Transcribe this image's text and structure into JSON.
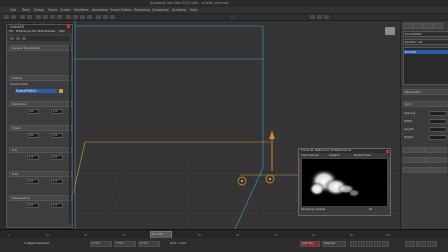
{
  "window": {
    "title": "Autodesk 3ds Max 2014  x64  -  smoke_sim.max"
  },
  "menu": [
    "Edit",
    "Tools",
    "Group",
    "Views",
    "Create",
    "Modifiers",
    "Animation",
    "Graph Editors",
    "Rendering",
    "Customize",
    "Scripting",
    "Help"
  ],
  "viewport": {
    "label": "[+] [Perspective] [Realistic]"
  },
  "fume_panel": {
    "title": "FumeFX",
    "menu": [
      "File",
      "Preferences",
      "Sim Mode",
      "Preview",
      "Help"
    ],
    "sections": [
      "General Parameters",
      "Output",
      "Simulation",
      "Smoke",
      "Fire",
      "Fuel",
      "Temperature"
    ],
    "path_label": "Output Path",
    "selected_item": "FumeFX001",
    "fields": [
      "0.0",
      "1.0",
      "0.0",
      "0.5",
      "1.0",
      "2.0",
      "0.0",
      "1.0",
      "0.0",
      "1.0"
    ]
  },
  "command_panel": {
    "name": "FumeFX001",
    "modifier_list": "Modifier List",
    "stack_item": "FumeFX",
    "sections": [
      "Parameters",
      "Grid",
      "Spacing",
      "Width",
      "Length",
      "Height"
    ]
  },
  "render_window": {
    "title": "Frame 40, RGBA Color 16 Bits/Channel",
    "toolbar": [
      "Area to Render",
      "Viewport",
      "Render Preset"
    ],
    "status": "Rendering complete",
    "frame": "40"
  },
  "timeline": {
    "frame": "40 / 100",
    "ticks": [
      "0",
      "10",
      "20",
      "30",
      "40",
      "50",
      "60",
      "70",
      "80",
      "90",
      "100"
    ]
  },
  "status": {
    "selection": "1 Object Selected",
    "x": "X: 0.0",
    "y": "Y: 0.0",
    "z": "Z: 0.0",
    "grid": "Grid = 10.0",
    "autokey": "Auto Key",
    "selected": "Selected"
  }
}
